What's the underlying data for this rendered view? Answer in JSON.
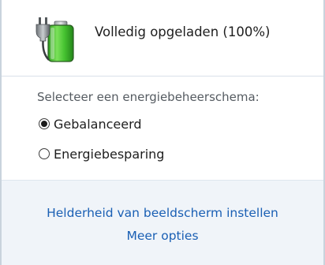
{
  "battery": {
    "status": "Volledig opgeladen (100%)",
    "charge_percent": 100,
    "plugged_in": true,
    "icon": "battery-charging-icon",
    "fill_color": "#3fbf2a"
  },
  "power_plans": {
    "heading": "Selecteer een energiebeheerschema:",
    "options": [
      {
        "label": "Gebalanceerd",
        "selected": true
      },
      {
        "label": "Energiebesparing",
        "selected": false
      }
    ]
  },
  "links": {
    "brightness": "Helderheid van beeldscherm instellen",
    "more_options": "Meer opties",
    "color": "#1a5fb4"
  }
}
